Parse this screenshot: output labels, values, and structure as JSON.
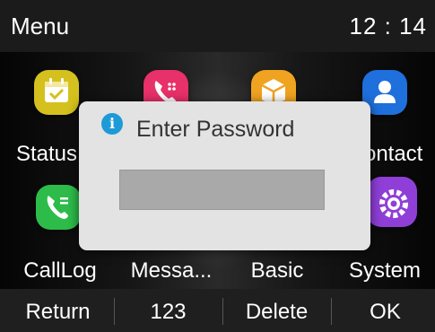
{
  "header": {
    "title": "Menu",
    "time": "12 : 14"
  },
  "apps": [
    {
      "label": "Status",
      "icon": "calendar-check-icon",
      "color": "#d4c11e"
    },
    {
      "label": "",
      "icon": "phone-keypad-icon",
      "color": "#e8306a"
    },
    {
      "label": "",
      "icon": "box-icon",
      "color": "#f0a320"
    },
    {
      "label": "Contact",
      "icon": "person-icon",
      "color": "#1f6fdc"
    },
    {
      "label": "CallLog",
      "icon": "phone-list-icon",
      "color": "#2dbc4a"
    },
    {
      "label": "Messa...",
      "icon": "message-icon",
      "color": "#e8306a"
    },
    {
      "label": "Basic",
      "icon": "basic-settings-icon",
      "color": "#f0a320"
    },
    {
      "label": "System",
      "icon": "gear-icon",
      "color": "#8f3fd8"
    }
  ],
  "dialog": {
    "title": "Enter Password",
    "password_value": "",
    "icon": "info-icon"
  },
  "softkeys": [
    {
      "label": "Return"
    },
    {
      "label": "123"
    },
    {
      "label": "Delete"
    },
    {
      "label": "OK"
    }
  ]
}
